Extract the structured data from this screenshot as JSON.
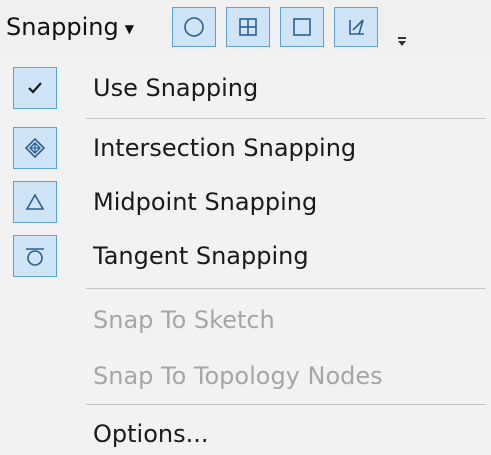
{
  "toolbar": {
    "menu_label": "Snapping",
    "buttons": [
      {
        "icon": "circle-icon"
      },
      {
        "icon": "grid-square-icon"
      },
      {
        "icon": "square-icon"
      },
      {
        "icon": "perpendicular-square-icon"
      }
    ]
  },
  "menu": {
    "items": [
      {
        "label": "Use Snapping",
        "checked": true,
        "enabled": true
      },
      {
        "label": "Intersection Snapping",
        "icon": "intersection-icon",
        "enabled": true
      },
      {
        "label": "Midpoint Snapping",
        "icon": "triangle-icon",
        "enabled": true
      },
      {
        "label": "Tangent Snapping",
        "icon": "tangent-icon",
        "enabled": true
      },
      {
        "label": "Snap To Sketch",
        "enabled": false
      },
      {
        "label": "Snap To Topology Nodes",
        "enabled": false
      },
      {
        "label": "Options...",
        "enabled": true
      }
    ]
  },
  "colors": {
    "button_fill": "#cfe4f7",
    "button_border": "#5ba3e0",
    "icon_stroke": "#2d5f93",
    "disabled_text": "#a6a6a6",
    "menu_background": "#f2f2f2"
  }
}
